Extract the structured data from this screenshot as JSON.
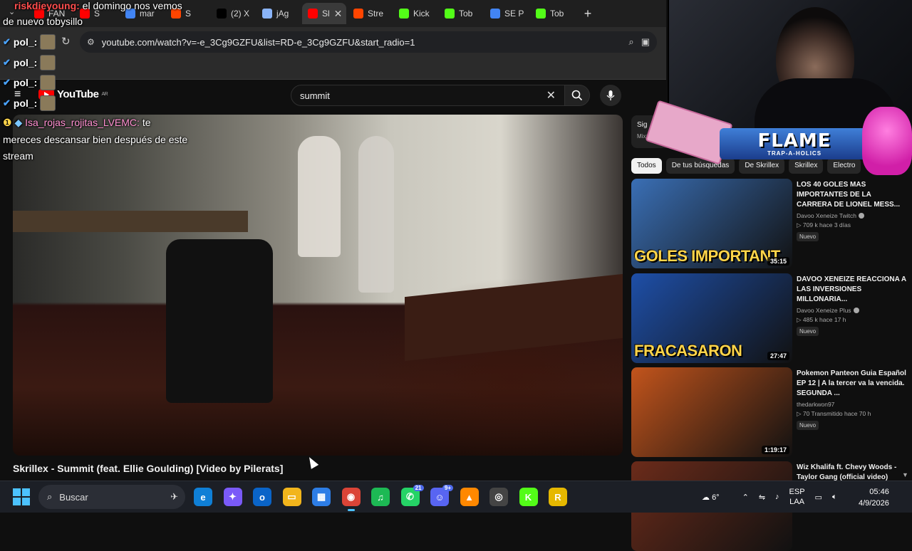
{
  "browser": {
    "tabs": [
      {
        "label": "FAN",
        "color": "#ff0000"
      },
      {
        "label": "S",
        "color": "#ff0000"
      },
      {
        "label": "mar",
        "color": "#4285f4"
      },
      {
        "label": "S",
        "color": "#ff4500"
      },
      {
        "label": "(2) X",
        "color": "#000000"
      },
      {
        "label": "jAg",
        "color": "#8ab4f8"
      },
      {
        "label": "Sl",
        "color": "#ff0000",
        "active": true
      },
      {
        "label": "Stre",
        "color": "#ff4500"
      },
      {
        "label": "Kick",
        "color": "#53fc18"
      },
      {
        "label": "Tob",
        "color": "#53fc18"
      },
      {
        "label": "SE P",
        "color": "#4285f4"
      },
      {
        "label": "Tob",
        "color": "#53fc18"
      }
    ],
    "new_tab": "+",
    "url": "youtube.com/watch?v=-e_3Cg9GZFU&list=RD-e_3Cg9GZFU&start_radio=1"
  },
  "youtube": {
    "logo": "YouTube",
    "region": "AR",
    "search_query": "summit",
    "video_title": "Skrillex - Summit (feat. Ellie Goulding) [Video by Pilerats]",
    "mix_card": {
      "title": "Sig",
      "subtitle": "Mix: S"
    },
    "chips": [
      {
        "label": "Todos",
        "active": true
      },
      {
        "label": "De tus búsquedas"
      },
      {
        "label": "De Skrillex"
      },
      {
        "label": "Skrillex"
      },
      {
        "label": "Electro"
      }
    ],
    "recommendations": [
      {
        "title": "LOS 40 GOLES MAS IMPORTANTES DE LA CARRERA DE LIONEL MESS...",
        "channel": "Davoo Xeneize Twitch",
        "verified": true,
        "stats": "▷ 709 k   hace 3 días",
        "badge": "Nuevo",
        "duration": "35:15",
        "caption": "GOLES IMPORTANT",
        "thumb_color": "#3a6fb5"
      },
      {
        "title": "DAVOO XENEIZE REACCIONA A LAS INVERSIONES MILLONARIA...",
        "channel": "Davoo Xeneize Plus",
        "verified": true,
        "stats": "▷ 485 k   hace 17 h",
        "badge": "Nuevo",
        "duration": "27:47",
        "caption": "FRACASARON",
        "thumb_color": "#1e4fa8"
      },
      {
        "title": "Pokemon Panteon Guia Español  EP 12  | A la tercer va la vencida. SEGUNDA ...",
        "channel": "thedarkwon97",
        "verified": false,
        "stats": "▷ 70  Transmitido hace 70 h",
        "badge": "Nuevo",
        "duration": "1:19:17",
        "caption": "",
        "thumb_color": "#c2541c"
      },
      {
        "title": "Wiz Khalifa ft. Chevy Woods - Taylor Gang (official video)",
        "channel": "",
        "verified": false,
        "stats": "",
        "badge": "",
        "duration": "",
        "caption": "",
        "thumb_color": "#6b2b1a"
      }
    ]
  },
  "overlay": {
    "top_chat": [
      {
        "user": "riskdieyoung:",
        "text": " el domingo nos vemos"
      },
      {
        "user": "",
        "text": "de nuevo tobysillo"
      }
    ],
    "pol_rows": [
      "pol_:",
      "pol_:",
      "pol_:",
      "pol_:"
    ],
    "chat_message": {
      "user": "Isa_rojas_rojitas_LVEMC:",
      "text_line1": " te",
      "text_line2": "mereces descansar bien después de este",
      "text_line3": "stream"
    },
    "banner_big": "FLAME",
    "banner_small": "TRAP-A-HOLICS"
  },
  "taskbar": {
    "search_label": "Buscar",
    "apps": [
      {
        "name": "edge",
        "glyph": "e",
        "color": "#0f7fd6"
      },
      {
        "name": "copilot",
        "glyph": "✦",
        "color": "#7a5af8"
      },
      {
        "name": "outlook",
        "glyph": "o",
        "color": "#0a64c8"
      },
      {
        "name": "explorer",
        "glyph": "▭",
        "color": "#f2b51c"
      },
      {
        "name": "store",
        "glyph": "▦",
        "color": "#2d7de6"
      },
      {
        "name": "chrome",
        "glyph": "◉",
        "color": "#db4437",
        "active": true
      },
      {
        "name": "spotify",
        "glyph": "♫",
        "color": "#1db954"
      },
      {
        "name": "whatsapp",
        "glyph": "✆",
        "color": "#25d366",
        "badge": "21"
      },
      {
        "name": "discord",
        "glyph": "☺",
        "color": "#5865f2",
        "badge": "9+"
      },
      {
        "name": "vlc",
        "glyph": "▲",
        "color": "#ff8800"
      },
      {
        "name": "obs",
        "glyph": "◎",
        "color": "#444444"
      },
      {
        "name": "kick",
        "glyph": "K",
        "color": "#53fc18"
      },
      {
        "name": "app-r",
        "glyph": "R",
        "color": "#e6b800"
      }
    ],
    "weather": "6°",
    "language": "ESP",
    "layout": "LAA",
    "time": "05:46",
    "date": "4/9/2026"
  }
}
